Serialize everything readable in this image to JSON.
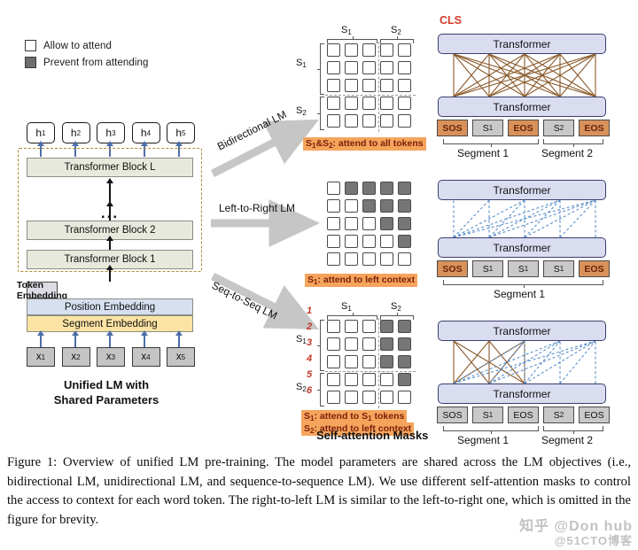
{
  "figure": {
    "legend": [
      {
        "swatch": "white-square-icon",
        "label": "Allow to attend"
      },
      {
        "swatch": "gray-square-icon",
        "label": "Prevent from attending"
      }
    ],
    "unified_lm": {
      "outputs": [
        "h1",
        "h2",
        "h3",
        "h4",
        "h5"
      ],
      "blocks": [
        "Transformer Block L",
        "Transformer Block 2",
        "Transformer Block 1"
      ],
      "ellipsis": "...",
      "embeddings": [
        "Token Embedding",
        "Position Embedding",
        "Segment Embedding"
      ],
      "inputs": [
        "x1",
        "x2",
        "x3",
        "x4",
        "x5"
      ],
      "caption_line1": "Unified LM with",
      "caption_line2": "Shared Parameters"
    },
    "arrows": [
      {
        "label": "Bidirectional LM",
        "direction": "up-right"
      },
      {
        "label": "Left-to-Right LM",
        "direction": "right"
      },
      {
        "label": "Seq-to-Seq LM",
        "direction": "down-right"
      }
    ],
    "masks_title": "Self-attention Masks",
    "masks": [
      {
        "name": "bidirectional-mask",
        "col_groups": [
          "S1",
          "S2"
        ],
        "row_groups": [
          "S1",
          "S2"
        ],
        "size": 5,
        "split_after": 3,
        "blocked_cells": [],
        "notes": [
          {
            "key": "S1&S2",
            "text": ": attend to all tokens"
          }
        ]
      },
      {
        "name": "left-to-right-mask",
        "col_groups": [],
        "row_groups": [],
        "size": 5,
        "split_after": 0,
        "blocked_cells": [
          [
            0,
            1
          ],
          [
            0,
            2
          ],
          [
            0,
            3
          ],
          [
            0,
            4
          ],
          [
            1,
            2
          ],
          [
            1,
            3
          ],
          [
            1,
            4
          ],
          [
            2,
            3
          ],
          [
            2,
            4
          ],
          [
            3,
            4
          ]
        ],
        "notes": [
          {
            "key": "S1",
            "text": ": attend to left context"
          }
        ]
      },
      {
        "name": "seq-to-seq-mask",
        "col_groups": [
          "S1",
          "S2"
        ],
        "row_groups": [
          "S1",
          "S2"
        ],
        "size": 5,
        "split_after": 3,
        "blocked_cells": [
          [
            0,
            3
          ],
          [
            0,
            4
          ],
          [
            1,
            3
          ],
          [
            1,
            4
          ],
          [
            2,
            3
          ],
          [
            2,
            4
          ],
          [
            3,
            4
          ]
        ],
        "notes": [
          {
            "key": "S1",
            "text": ": attend to S1 tokens"
          },
          {
            "key": "S2",
            "text": ": attend to left context"
          }
        ],
        "watermark_numbers": [
          "1",
          "2",
          "3",
          "4",
          "5",
          "6"
        ]
      }
    ],
    "diagrams": [
      {
        "name": "bidirectional-lm-diagram",
        "cls_label": "CLS",
        "layers": [
          "Transformer",
          "Transformer"
        ],
        "tokens": [
          {
            "text": "SOS",
            "style": "orange"
          },
          {
            "text": "S1",
            "style": "gray"
          },
          {
            "text": "EOS",
            "style": "orange"
          },
          {
            "text": "S2",
            "style": "gray"
          },
          {
            "text": "EOS",
            "style": "orange"
          }
        ],
        "segments": [
          "Segment 1",
          "Segment 2"
        ],
        "edge_style": "brown-solid"
      },
      {
        "name": "left-to-right-lm-diagram",
        "cls_label": "",
        "layers": [
          "Transformer",
          "Transformer"
        ],
        "tokens": [
          {
            "text": "SOS",
            "style": "orange"
          },
          {
            "text": "S1",
            "style": "gray"
          },
          {
            "text": "S1",
            "style": "gray"
          },
          {
            "text": "S1",
            "style": "gray"
          },
          {
            "text": "EOS",
            "style": "orange"
          }
        ],
        "segments": [
          "Segment 1"
        ],
        "edge_style": "blue-dashed"
      },
      {
        "name": "seq-to-seq-lm-diagram",
        "cls_label": "",
        "layers": [
          "Transformer",
          "Transformer"
        ],
        "tokens": [
          {
            "text": "SOS",
            "style": "gray"
          },
          {
            "text": "S1",
            "style": "gray"
          },
          {
            "text": "EOS",
            "style": "gray"
          },
          {
            "text": "S2",
            "style": "gray"
          },
          {
            "text": "EOS",
            "style": "gray"
          }
        ],
        "segments": [
          "Segment 1",
          "Segment 2"
        ],
        "edge_style": "brown-solid-and-blue-dashed"
      }
    ],
    "colors": {
      "highlight_bg": "#f5a45c",
      "highlight_fg": "#7b1f0a",
      "cls_red": "#d33c2a",
      "dashed_border": "#b58a34",
      "transformer_fill": "#dadcf0",
      "transformer_stroke": "#3a3f6b",
      "token_orange": "#d8915b",
      "token_gray": "#c9c9c9",
      "block_fill": "#e8e9dd",
      "segment_embedding": "#fbe3a3",
      "position_embedding": "#d6e0f0",
      "token_embedding": "#dcdce4",
      "blocked_cell": "#767676",
      "brown_edge": "#8a5a2b",
      "blue_edge": "#5b8fc9"
    }
  },
  "caption": {
    "text": "Figure 1: Overview of unified LM pre-training. The model parameters are shared across the LM objectives (i.e., bidirectional LM, unidirectional LM, and sequence-to-sequence LM). We use different self-attention masks to control the access to context for each word token. The right-to-left LM is similar to the left-to-right one, which is omitted in the figure for brevity."
  },
  "watermark": {
    "line1": "知乎 @Don hub",
    "line2": "@51CTO博客"
  }
}
